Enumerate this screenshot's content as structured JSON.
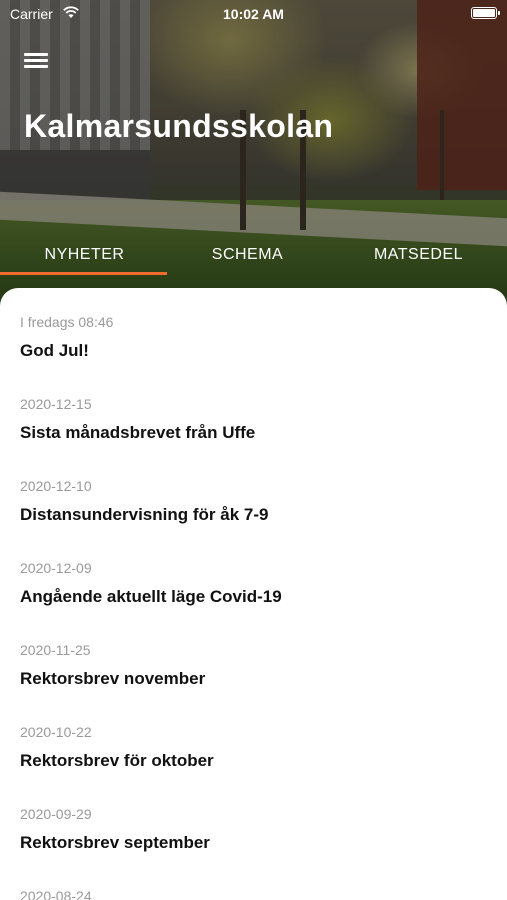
{
  "status_bar": {
    "carrier": "Carrier",
    "wifi_icon": "wifi-icon",
    "time": "10:02 AM",
    "battery_icon": "battery-icon"
  },
  "header": {
    "menu_icon": "hamburger-menu-icon",
    "title": "Kalmarsundsskolan"
  },
  "tabs": [
    {
      "label": "NYHETER",
      "active": true
    },
    {
      "label": "SCHEMA",
      "active": false
    },
    {
      "label": "MATSEDEL",
      "active": false
    }
  ],
  "colors": {
    "accent": "#ee6b2d",
    "date_text": "#9a9a9a",
    "title_text": "#111111"
  },
  "news": [
    {
      "date": "I fredags 08:46",
      "title": "God Jul!"
    },
    {
      "date": "2020-12-15",
      "title": "Sista månadsbrevet från Uffe"
    },
    {
      "date": "2020-12-10",
      "title": "Distansundervisning för åk 7-9"
    },
    {
      "date": "2020-12-09",
      "title": "Angående aktuellt läge Covid-19"
    },
    {
      "date": "2020-11-25",
      "title": "Rektorsbrev november"
    },
    {
      "date": "2020-10-22",
      "title": "Rektorsbrev för oktober"
    },
    {
      "date": "2020-09-29",
      "title": "Rektorsbrev september"
    },
    {
      "date": "2020-08-24",
      "title": ""
    }
  ]
}
